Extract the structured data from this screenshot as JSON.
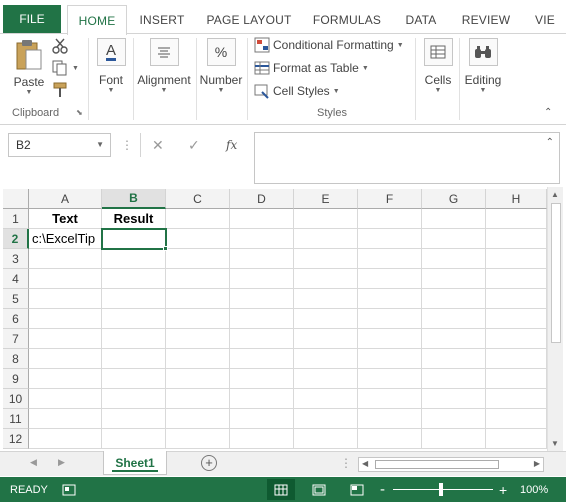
{
  "ribbon_tabs": {
    "file": "FILE",
    "home": "HOME",
    "insert": "INSERT",
    "page_layout": "PAGE LAYOUT",
    "formulas": "FORMULAS",
    "data": "DATA",
    "review": "REVIEW",
    "view_partial": "VIE"
  },
  "ribbon": {
    "paste": "Paste",
    "clipboard_label": "Clipboard",
    "font": "Font",
    "alignment": "Alignment",
    "number": "Number",
    "number_icon": "%",
    "conditional_formatting": "Conditional Formatting",
    "format_as_table": "Format as Table",
    "cell_styles": "Cell Styles",
    "styles_label": "Styles",
    "cells": "Cells",
    "editing": "Editing",
    "font_icon": "A"
  },
  "formula_bar": {
    "name_box": "B2",
    "fx": "fx",
    "formula": ""
  },
  "grid": {
    "columns": [
      "A",
      "B",
      "C",
      "D",
      "E",
      "F",
      "G",
      "H"
    ],
    "rows": [
      "1",
      "2",
      "3",
      "4",
      "5",
      "6",
      "7",
      "8",
      "9",
      "10",
      "11",
      "12"
    ],
    "cells": {
      "A1": "Text",
      "B1": "Result",
      "A2": "c:\\ExcelTip",
      "B2": ""
    },
    "active_cell": "B2"
  },
  "sheets": {
    "tab": "Sheet1",
    "add": "+"
  },
  "status": {
    "ready": "READY",
    "zoom": "100%",
    "minus": "-",
    "plus": "+"
  },
  "colors": {
    "accent": "#217346",
    "statusbar": "#217346"
  }
}
